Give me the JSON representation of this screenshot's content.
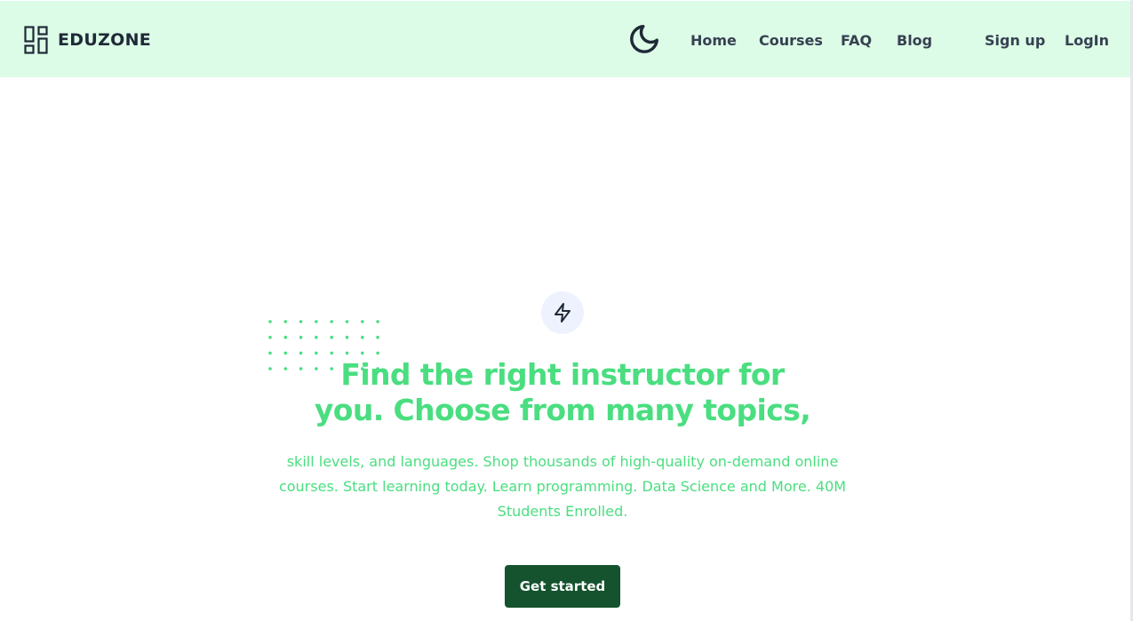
{
  "header": {
    "brand": "EDUZONE",
    "logo_icon": "dashboard-layout-icon",
    "theme_icon": "moon-icon",
    "nav": [
      {
        "label": "Home"
      },
      {
        "label": "Courses"
      },
      {
        "label": "FAQ"
      },
      {
        "label": "Blog"
      }
    ],
    "signup_label": "Sign up",
    "login_label": "LogIn"
  },
  "hero": {
    "badge_icon": "lightning-icon",
    "headline_line1": "Find the right instructor for",
    "headline_line2": "you. Choose from many topics,",
    "subtext": "skill levels, and languages. Shop thousands of high-quality on-demand online courses. Start learning today. Learn programming. Data Science and More. 40M Students Enrolled.",
    "cta_label": "Get started"
  },
  "colors": {
    "header_bg": "#dcfce7",
    "accent_green": "#4ade80",
    "button_bg": "#14532d",
    "text_dark": "#1f2937"
  }
}
